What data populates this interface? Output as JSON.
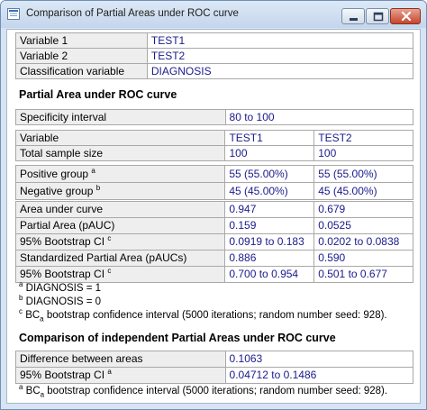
{
  "window": {
    "title": "Comparison of Partial Areas under ROC curve",
    "min_icon": "minimize-icon",
    "max_icon": "maximize-icon",
    "close_icon": "close-icon",
    "close_color": "#c5452b"
  },
  "vars": {
    "rows": [
      {
        "label": "Variable 1",
        "value": "TEST1"
      },
      {
        "label": "Variable 2",
        "value": "TEST2"
      },
      {
        "label": "Classification variable",
        "value": "DIAGNOSIS"
      }
    ]
  },
  "partial": {
    "heading": "Partial Area under ROC curve",
    "spec_label": "Specificity interval",
    "spec_value": "80 to 100",
    "col_variable": "Variable",
    "col_test1": "TEST1",
    "col_test2": "TEST2",
    "total_label": "Total sample size",
    "total_test1": "100",
    "total_test2": "100",
    "pos_label": "Positive group",
    "pos_sup": "a",
    "pos_test1": "55 (55.00%)",
    "pos_test2": "55 (55.00%)",
    "neg_label": "Negative group",
    "neg_sup": "b",
    "neg_test1": "45 (45.00%)",
    "neg_test2": "45 (45.00%)",
    "stats": [
      {
        "label": "Area under curve",
        "sup": "",
        "t1": "0.947",
        "t2": "0.679"
      },
      {
        "label": "Partial Area (pAUC)",
        "sup": "",
        "t1": "0.159",
        "t2": "0.0525"
      },
      {
        "label": "95% Bootstrap CI",
        "sup": "c",
        "t1": "0.0919 to 0.183",
        "t2": "0.0202 to 0.0838"
      },
      {
        "label": "Standardized Partial Area (pAUCs)",
        "sup": "",
        "t1": "0.886",
        "t2": "0.590"
      },
      {
        "label": "95% Bootstrap CI",
        "sup": "c",
        "t1": "0.700 to 0.954",
        "t2": "0.501 to 0.677"
      }
    ],
    "notes": [
      {
        "sup": "a",
        "text": " DIAGNOSIS = 1"
      },
      {
        "sup": "b",
        "text": " DIAGNOSIS = 0"
      }
    ],
    "note_c_sup": "c",
    "note_c_pre": " BC",
    "note_c_sub": "a",
    "note_c_post": " bootstrap confidence interval (5000 iterations; random number seed: 928)."
  },
  "comparison": {
    "heading": "Comparison of independent Partial Areas under ROC curve",
    "diff_label": "Difference between areas",
    "diff_value": "0.1063",
    "ci_label": "95% Bootstrap CI",
    "ci_sup": "a",
    "ci_value": "0.04712 to 0.1486",
    "note_sup": "a",
    "note_pre": " BC",
    "note_sub": "a",
    "note_post": " bootstrap confidence interval (5000 iterations; random number seed: 928)."
  }
}
